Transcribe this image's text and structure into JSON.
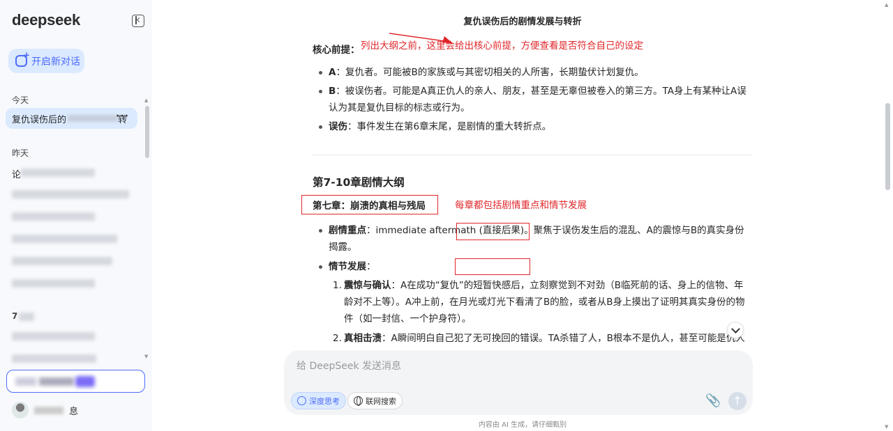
{
  "sidebar": {
    "logo": "deepseek",
    "new_chat_label": "开启新对话",
    "section_today": "今天",
    "active_conversation_prefix": "复仇误伤后的",
    "active_conversation_suffix": "转",
    "more": "···",
    "section_yesterday": "昨天",
    "first_conversation_prefix": "论",
    "section_7days": "7",
    "profile_suffix": "息"
  },
  "main": {
    "doc_title": "复仇误伤后的剧情发展与转折",
    "core_label": "核心前提：",
    "core_note": "列出大纲之前，这里会给出核心前提，方便查看是否符合自己的设定",
    "premises": [
      {
        "term": "A",
        "text": "：复仇者。可能被B的家族或与其密切相关的人所害，长期蛰伏计划复仇。"
      },
      {
        "term": "B",
        "text": "：被误伤者。可能是A真正仇人的亲人、朋友，甚至是无辜但被卷入的第三方。TA身上有某种让A误认为其是复仇目标的标志或行为。"
      },
      {
        "term": "误伤",
        "text": "：事件发生在第6章末尾，是剧情的重大转折点。"
      }
    ],
    "outline_title": "第7-10章剧情大纲",
    "chapter_title": "第七章：崩溃的真相与残局",
    "chapter_note": "每章都包括剧情重点和情节发展",
    "focus_term": "剧情重点",
    "focus_text": "：immediate aftermath (直接后果)。聚焦于误伤发生后的混乱、A的震惊与B的真实身份揭露。",
    "dev_term": "情节发展",
    "dev_colon": "：",
    "numbered": [
      {
        "num": "1.",
        "term": "震惊与确认",
        "text": "：A在成功“复仇”的短暂快感后，立刻察觉到不对劲（B临死前的话、身上的信物、年龄对不上等）。A冲上前，在月光或灯光下看清了B的脸，或者从B身上摸出了证明其真实身份的物件（如一封信、一个护身符）。"
      },
      {
        "num": "2.",
        "term": "真相击溃",
        "text": "：A瞬间明白自己犯了无可挽回的错误。TA杀错了人，B根本不是仇人，甚至可能是仇人想"
      }
    ]
  },
  "input": {
    "placeholder": "给 DeepSeek 发送消息",
    "deep_think": "深度思考",
    "web_search": "联网搜索",
    "send": "↑",
    "clip": "📎"
  },
  "footer": "内容由 AI 生成，请仔细甄别",
  "colors": {
    "accent": "#4d6bfe",
    "annotation_red": "#e0262a",
    "sidebar_bg": "#f7f9fc"
  }
}
